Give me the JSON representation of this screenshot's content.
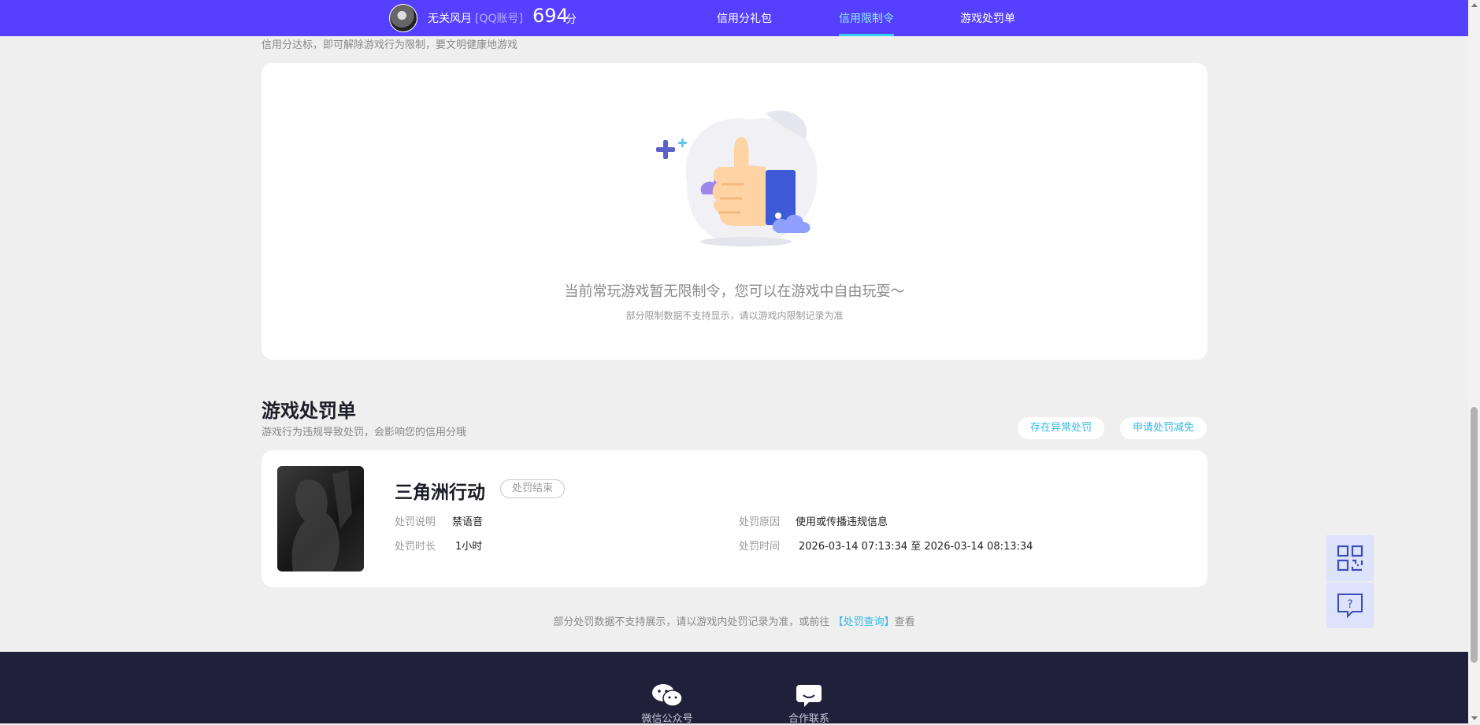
{
  "header": {
    "user_name": "无关风月",
    "account_type": "[QQ账号]",
    "score": "694",
    "score_unit": "分",
    "nav": [
      {
        "label": "信用分礼包",
        "active": false
      },
      {
        "label": "信用限制令",
        "active": true
      },
      {
        "label": "游戏处罚单",
        "active": false
      }
    ],
    "active_color": "#8fe7ff",
    "bar_color": "#5540ff"
  },
  "restriction": {
    "subtitle": "信用分达标，即可解除游戏行为限制，要文明健康地游戏",
    "empty_title": "当前常玩游戏暂无限制令，您可以在游戏中自由玩耍～",
    "empty_note": "部分限制数据不支持显示，请以游戏内限制记录为准"
  },
  "penalty": {
    "title": "游戏处罚单",
    "subtitle": "游戏行为违规导致处罚，会影响您的信用分哦",
    "actions": [
      {
        "label": "存在异常处罚"
      },
      {
        "label": "申请处罚减免"
      }
    ],
    "record": {
      "game": "三角洲行动",
      "status": "处罚结束",
      "desc_label": "处罚说明",
      "desc_value": "禁语音",
      "duration_label": "处罚时长",
      "duration_value": "1小时",
      "reason_label": "处罚原因",
      "reason_value": "使用或传播违规信息",
      "time_label": "处罚时间",
      "time_start": "2026-03-14 07:13:34",
      "time_sep": "至",
      "time_end": "2026-03-14 08:13:34"
    },
    "note_prefix": "部分处罚数据不支持展示，请以游戏内处罚记录为准，或前往",
    "note_link": "【处罚查询】",
    "note_suffix": "查看"
  },
  "footer": {
    "items": [
      {
        "label": "微信公众号",
        "icon": "wechat-icon"
      },
      {
        "label": "合作联系",
        "icon": "chat-bubble-icon"
      }
    ]
  },
  "side": {
    "buttons": [
      {
        "icon": "qr-code-icon"
      },
      {
        "icon": "help-message-icon"
      }
    ]
  }
}
